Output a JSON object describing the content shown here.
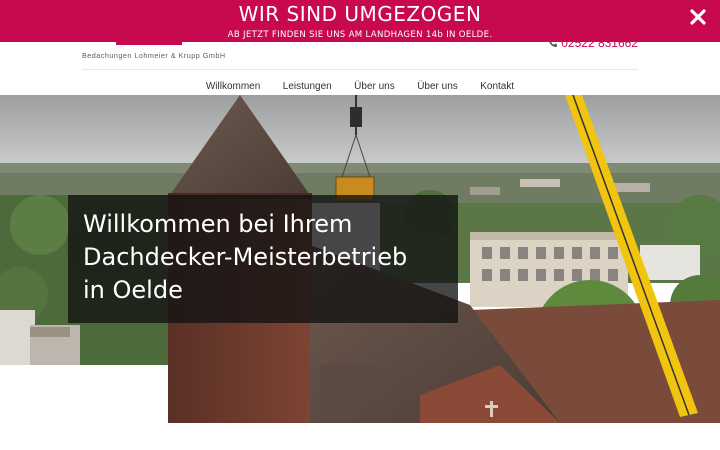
{
  "notice": {
    "title": "WIR SIND UMGEZOGEN",
    "subtitle": "AB JETZT FINDEN SIE UNS AM LANDHAGEN 14b IN OELDE.",
    "close_icon": "close-icon",
    "background_color": "#c8094f"
  },
  "header": {
    "company_name": "Bedachungen Lohmeier & Krupp GmbH",
    "phone": "02522 831662",
    "phone_icon": "phone-icon"
  },
  "nav": {
    "items": [
      {
        "label": "Willkommen"
      },
      {
        "label": "Leistungen"
      },
      {
        "label": "Über uns"
      },
      {
        "label": "Über uns"
      },
      {
        "label": "Kontakt"
      }
    ]
  },
  "hero": {
    "lines": [
      "Willkommen bei Ihrem",
      "Dachdecker-Meisterbetrieb",
      "in Oelde"
    ]
  }
}
